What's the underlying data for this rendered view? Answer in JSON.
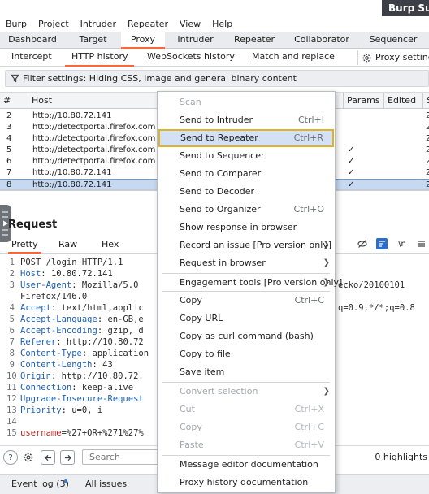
{
  "window": {
    "title": "Burp Su"
  },
  "menubar": {
    "items": [
      "Burp",
      "Project",
      "Intruder",
      "Repeater",
      "View",
      "Help"
    ]
  },
  "main_tabs": {
    "items": [
      "Dashboard",
      "Target",
      "Proxy",
      "Intruder",
      "Repeater",
      "Collaborator",
      "Sequencer"
    ],
    "active": "Proxy"
  },
  "proxy_tabs": {
    "items": [
      "Intercept",
      "HTTP history",
      "WebSockets history",
      "Match and replace"
    ],
    "active": "HTTP history",
    "settings_label": "Proxy settings"
  },
  "filter": {
    "label": "Filter settings: Hiding CSS, image and general binary content"
  },
  "history_table": {
    "columns": {
      "num": "#",
      "host": "Host",
      "params": "Params",
      "edited": "Edited",
      "s": "S"
    },
    "rows": [
      {
        "num": "2",
        "host": "http://10.80.72.141",
        "params": "",
        "edited": "",
        "s": "2"
      },
      {
        "num": "3",
        "host": "http://detectportal.firefox.com",
        "params": "",
        "edited": "",
        "s": "2"
      },
      {
        "num": "4",
        "host": "http://detectportal.firefox.com",
        "params": "",
        "edited": "",
        "s": "2"
      },
      {
        "num": "5",
        "host": "http://detectportal.firefox.com",
        "params": "✓",
        "edited": "",
        "s": "2"
      },
      {
        "num": "6",
        "host": "http://detectportal.firefox.com",
        "params": "✓",
        "edited": "",
        "s": "2"
      },
      {
        "num": "7",
        "host": "http://10.80.72.141",
        "params": "✓",
        "edited": "",
        "s": "2"
      },
      {
        "num": "8",
        "host": "http://10.80.72.141",
        "params": "✓",
        "edited": "",
        "s": "2"
      }
    ],
    "selected_row": "8"
  },
  "request": {
    "title": "Request",
    "tabs": [
      "Pretty",
      "Raw",
      "Hex"
    ],
    "active_tab": "Pretty",
    "newline_toggle": "\\n",
    "lines": [
      {
        "n": "1",
        "text": "POST /login HTTP/1.1"
      },
      {
        "n": "2",
        "name": "Host",
        "text": ": 10.80.72.141"
      },
      {
        "n": "3",
        "name": "User-Agent",
        "text": ": Mozilla/5.0",
        "tail": "ecko/20100101"
      },
      {
        "n": "",
        "text": "Firefox/146.0"
      },
      {
        "n": "4",
        "name": "Accept",
        "text": ": text/html,applic",
        "tail": "q=0.9,*/*;q=0.8"
      },
      {
        "n": "5",
        "name": "Accept-Language",
        "text": ": en-GB,e"
      },
      {
        "n": "6",
        "name": "Accept-Encoding",
        "text": ": gzip, d"
      },
      {
        "n": "7",
        "name": "Referer",
        "text": ": http://10.80.72"
      },
      {
        "n": "8",
        "name": "Content-Type",
        "text": ": application"
      },
      {
        "n": "9",
        "name": "Content-Length",
        "text": ": 43"
      },
      {
        "n": "10",
        "name": "Origin",
        "text": ": http://10.80.72."
      },
      {
        "n": "11",
        "name": "Connection",
        "text": ": keep-alive"
      },
      {
        "n": "12",
        "name": "Upgrade-Insecure-Request",
        "text": ""
      },
      {
        "n": "13",
        "name": "Priority",
        "text": ": u=0, i"
      },
      {
        "n": "14",
        "text": ""
      },
      {
        "n": "15",
        "name": "username",
        "text": "=%27+OR+%271%27%"
      }
    ]
  },
  "search": {
    "placeholder": "Search",
    "highlights": "0 highlights"
  },
  "statusbar": {
    "event_log": "Event log (3)",
    "all_issues": "All issues"
  },
  "context_menu": {
    "items": [
      {
        "label": "Scan",
        "shortcut": "",
        "disabled": true
      },
      {
        "label": "Send to Intruder",
        "shortcut": "Ctrl+I"
      },
      {
        "label": "Send to Repeater",
        "shortcut": "Ctrl+R",
        "highlighted": true
      },
      {
        "label": "Send to Sequencer",
        "shortcut": ""
      },
      {
        "label": "Send to Comparer",
        "shortcut": ""
      },
      {
        "label": "Send to Decoder",
        "shortcut": ""
      },
      {
        "label": "Send to Organizer",
        "shortcut": "Ctrl+O"
      },
      {
        "label": "Show response in browser",
        "shortcut": ""
      },
      {
        "label": "Record an issue [Pro version only]",
        "submenu": true
      },
      {
        "label": "Request in browser",
        "submenu": true
      },
      {
        "label": "Engagement tools [Pro version only]",
        "submenu": true
      },
      {
        "label": "Copy",
        "shortcut": "Ctrl+C"
      },
      {
        "label": "Copy URL",
        "shortcut": ""
      },
      {
        "label": "Copy as curl command (bash)",
        "shortcut": ""
      },
      {
        "label": "Copy to file",
        "shortcut": ""
      },
      {
        "label": "Save item",
        "shortcut": ""
      },
      {
        "label": "Convert selection",
        "submenu": true,
        "disabled": true
      },
      {
        "label": "Cut",
        "shortcut": "Ctrl+X",
        "disabled": true
      },
      {
        "label": "Copy",
        "shortcut": "Ctrl+C",
        "disabled": true
      },
      {
        "label": "Paste",
        "shortcut": "Ctrl+V",
        "disabled": true
      },
      {
        "label": "Message editor documentation",
        "shortcut": ""
      },
      {
        "label": "Proxy history documentation",
        "shortcut": ""
      }
    ]
  },
  "colors": {
    "accent": "#ff6633",
    "selection": "#c6d9f1",
    "menu_highlight_border": "#e3b220"
  }
}
